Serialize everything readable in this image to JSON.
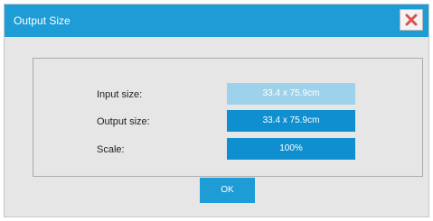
{
  "dialog": {
    "title": "Output Size",
    "close_icon": "close-icon",
    "accent_color": "#1d9cd6"
  },
  "fields": [
    {
      "label": "Input size:",
      "value": "33.4 x 75.9cm",
      "state": "disabled"
    },
    {
      "label": "Output size:",
      "value": "33.4 x 75.9cm",
      "state": "editable"
    },
    {
      "label": "Scale:",
      "value": "100%",
      "state": "editable"
    }
  ],
  "buttons": {
    "ok_label": "OK"
  }
}
